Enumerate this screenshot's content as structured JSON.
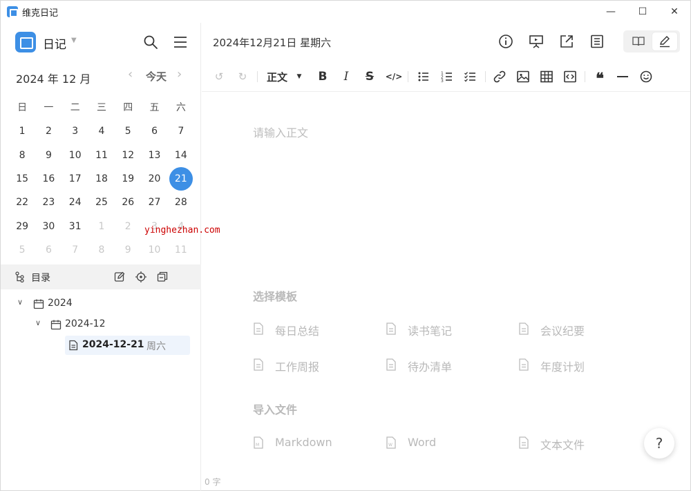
{
  "window": {
    "title": "维克日记",
    "controls": [
      "—",
      "☐",
      "✕"
    ]
  },
  "sidebar": {
    "title": "日记",
    "calendar": {
      "month_label": "2024 年 12 月",
      "today_label": "今天",
      "weekdays": [
        "日",
        "一",
        "二",
        "三",
        "四",
        "五",
        "六"
      ],
      "weeks": [
        [
          "1",
          "2",
          "3",
          "4",
          "5",
          "6",
          "7"
        ],
        [
          "8",
          "9",
          "10",
          "11",
          "12",
          "13",
          "14"
        ],
        [
          "15",
          "16",
          "17",
          "18",
          "19",
          "20",
          "21"
        ],
        [
          "22",
          "23",
          "24",
          "25",
          "26",
          "27",
          "28"
        ],
        [
          "29",
          "30",
          "31",
          "1",
          "2",
          "3",
          "4"
        ],
        [
          "5",
          "6",
          "7",
          "8",
          "9",
          "10",
          "11"
        ]
      ],
      "selected": "21"
    },
    "directory": {
      "label": "目录"
    },
    "tree": {
      "year": "2024",
      "month": "2024-12",
      "entry": "2024-12-21",
      "entry_weekday": "周六"
    }
  },
  "main": {
    "date_title": "2024年12月21日 星期六",
    "toolbar": {
      "paragraph_style": "正文"
    },
    "editor_placeholder": "请输入正文",
    "templates_title": "选择模板",
    "templates": [
      "每日总结",
      "读书笔记",
      "会议纪要",
      "工作周报",
      "待办清单",
      "年度计划"
    ],
    "import_title": "导入文件",
    "imports": [
      "Markdown",
      "Word",
      "文本文件"
    ],
    "word_count": "0 字",
    "help": "?"
  },
  "watermark": "yinghezhan.com",
  "colors": {
    "accent": "#3d8fe5",
    "muted_text": "#b9b9b9"
  }
}
